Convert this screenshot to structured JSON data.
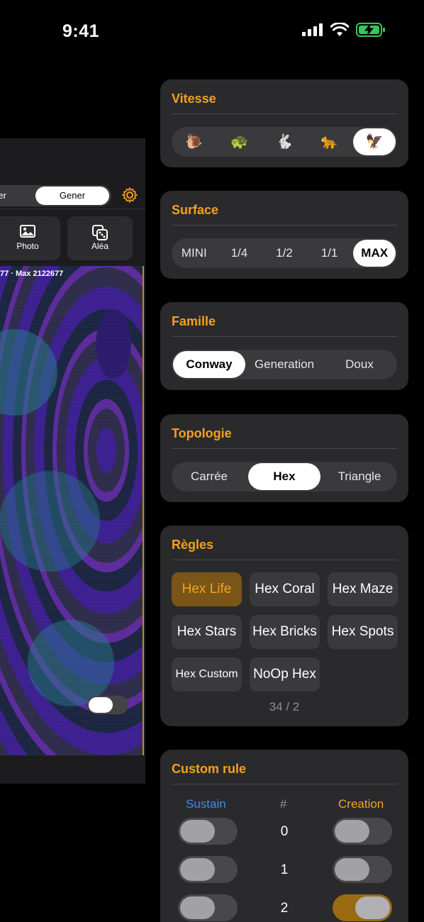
{
  "status_bar": {
    "time": "9:41"
  },
  "preview": {
    "mode_partial": "ner",
    "mode_selected": "Gener",
    "tools": [
      {
        "label": "Photo",
        "icon": "photo-icon"
      },
      {
        "label": "Aléa",
        "icon": "dice-icon"
      }
    ],
    "info": "77 · Max 2122677"
  },
  "vitesse": {
    "title": "Vitesse",
    "options": [
      "🐌",
      "🐢",
      "🐇",
      "🐆",
      "🦅"
    ],
    "icons": [
      "snail-icon",
      "turtle-icon",
      "rabbit-icon",
      "leopard-icon",
      "eagle-icon"
    ],
    "selected": 4
  },
  "surface": {
    "title": "Surface",
    "options": [
      "MINI",
      "1/4",
      "1/2",
      "1/1",
      "MAX"
    ],
    "selected": 4
  },
  "famille": {
    "title": "Famille",
    "options": [
      "Conway",
      "Generation",
      "Doux"
    ],
    "selected": 0
  },
  "topologie": {
    "title": "Topologie",
    "options": [
      "Carrée",
      "Hex",
      "Triangle"
    ],
    "selected": 1
  },
  "regles": {
    "title": "Règles",
    "rules": [
      "Hex Life",
      "Hex Coral",
      "Hex Maze",
      "Hex Stars",
      "Hex Bricks",
      "Hex Spots",
      "Hex Custom",
      "NoOp Hex"
    ],
    "active": 0,
    "code": "34 / 2"
  },
  "custom_rule": {
    "title": "Custom rule",
    "sustain_label": "Sustain",
    "hash_label": "#",
    "creation_label": "Creation",
    "rows": [
      {
        "n": "0",
        "sustain": false,
        "creation": false
      },
      {
        "n": "1",
        "sustain": false,
        "creation": false
      },
      {
        "n": "2",
        "sustain": false,
        "creation": true
      }
    ],
    "colors": {
      "sustain": "#3a8ee6",
      "creation": "#f4a11e",
      "accent": "#f4a11e"
    }
  }
}
